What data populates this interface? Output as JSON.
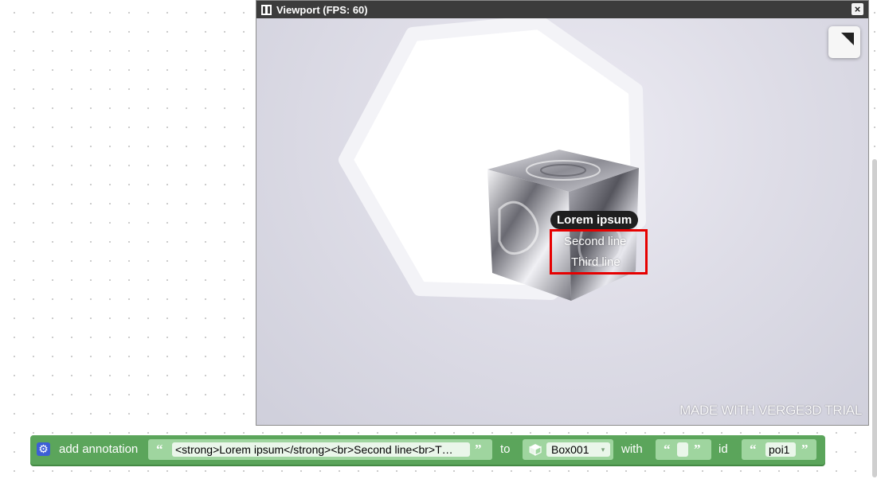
{
  "viewport": {
    "title": "Viewport (FPS: 60)",
    "close_glyph": "×",
    "annotation": {
      "title": "Lorem ipsum",
      "line2": "Second line",
      "line3": "Third line"
    },
    "watermark": "MADE WITH VERGE3D TRIAL"
  },
  "block": {
    "gear_glyph": "⚙",
    "label": "add annotation",
    "text_value": "<strong>Lorem ipsum</strong><br>Second line<br>T…",
    "to_label": "to",
    "object_value": "Box001",
    "with_label": "with",
    "with_value": "",
    "id_label": "id",
    "id_value": "poi1",
    "quote_open": "“",
    "quote_close": "”",
    "dropdown_glyph": "▾"
  },
  "colors": {
    "block_green": "#5ba55b",
    "highlight_red": "#e60000",
    "titlebar": "#3c3c3c"
  }
}
